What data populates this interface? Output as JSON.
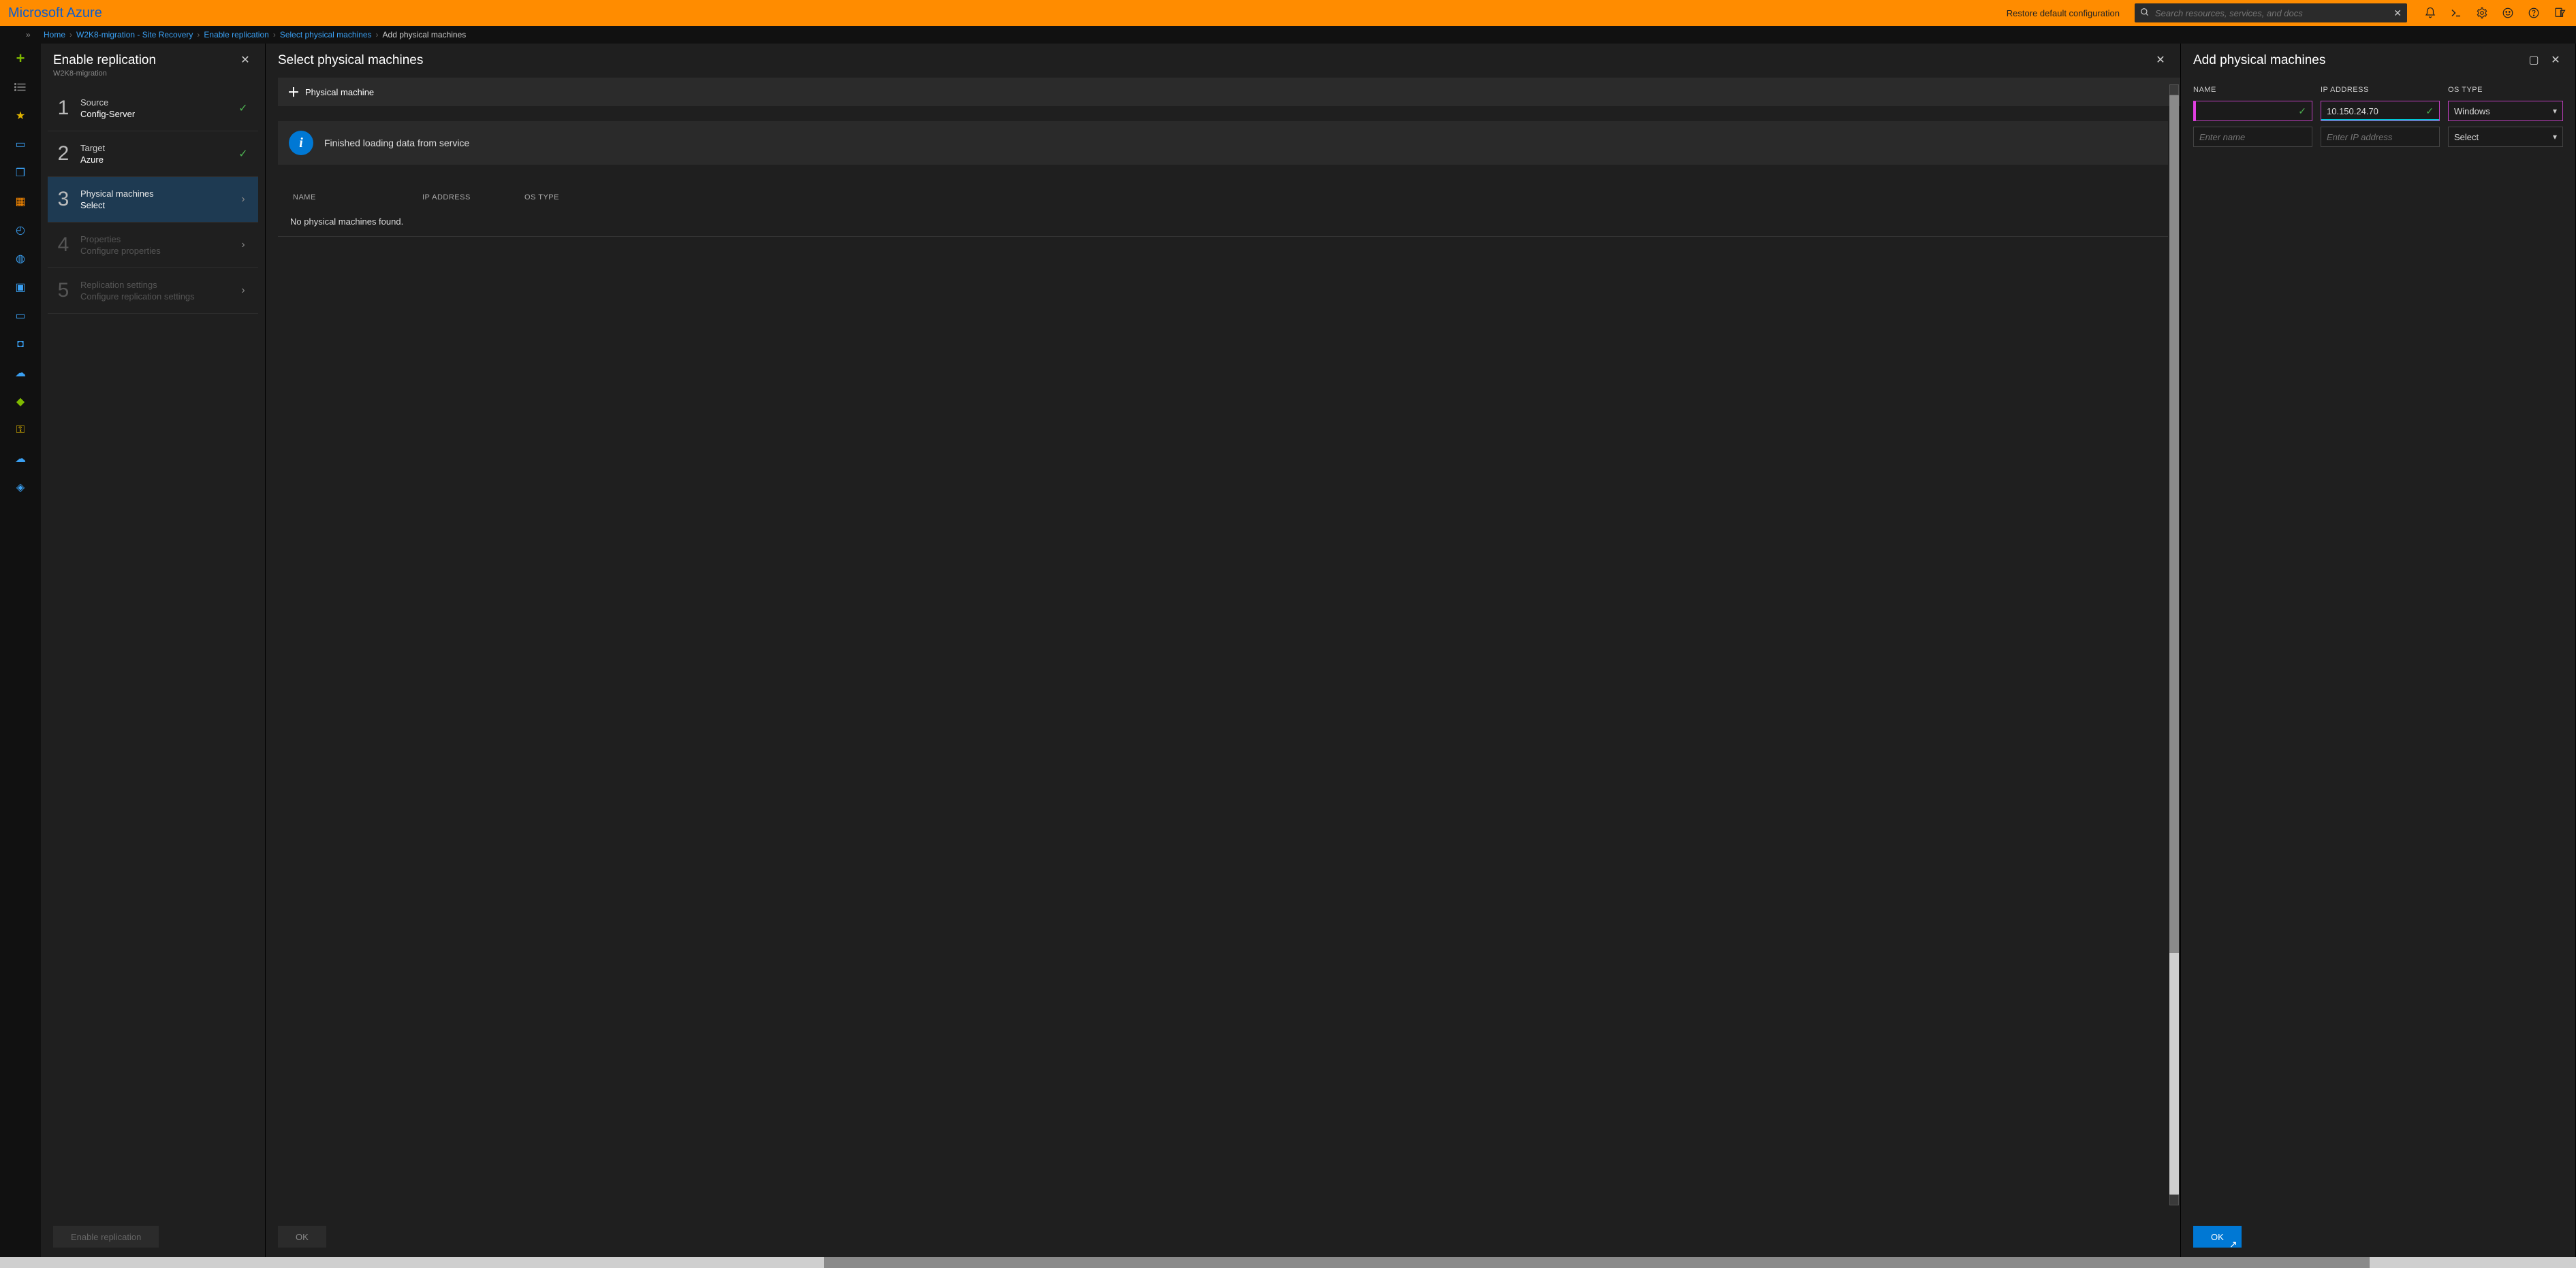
{
  "topbar": {
    "brand": "Microsoft Azure",
    "restore": "Restore default configuration",
    "search_placeholder": "Search resources, services, and docs"
  },
  "breadcrumbs": {
    "items": [
      "Home",
      "W2K8-migration - Site Recovery",
      "Enable replication",
      "Select physical machines",
      "Add physical machines"
    ]
  },
  "blade1": {
    "title": "Enable replication",
    "subtitle": "W2K8-migration",
    "steps": [
      {
        "num": "1",
        "line1": "Source",
        "line2": "Config-Server",
        "state": "done"
      },
      {
        "num": "2",
        "line1": "Target",
        "line2": "Azure",
        "state": "done"
      },
      {
        "num": "3",
        "line1": "Physical machines",
        "line2": "Select",
        "state": "active"
      },
      {
        "num": "4",
        "line1": "Properties",
        "line2": "Configure properties",
        "state": "disabled"
      },
      {
        "num": "5",
        "line1": "Replication settings",
        "line2": "Configure replication settings",
        "state": "disabled"
      }
    ],
    "footer_btn": "Enable replication"
  },
  "blade2": {
    "title": "Select physical machines",
    "add_btn": "Physical machine",
    "banner": "Finished loading data from service",
    "cols": {
      "name": "NAME",
      "ip": "IP ADDRESS",
      "os": "OS TYPE"
    },
    "empty": "No physical machines found.",
    "footer_btn": "OK"
  },
  "blade3": {
    "title": "Add physical machines",
    "cols": {
      "name": "NAME",
      "ip": "IP ADDRESS",
      "os": "OS TYPE"
    },
    "row1": {
      "name": "",
      "ip": "10.150.24.70",
      "os": "Windows"
    },
    "row2": {
      "name_ph": "Enter name",
      "ip_ph": "Enter IP address",
      "os": "Select"
    },
    "footer_btn": "OK"
  }
}
